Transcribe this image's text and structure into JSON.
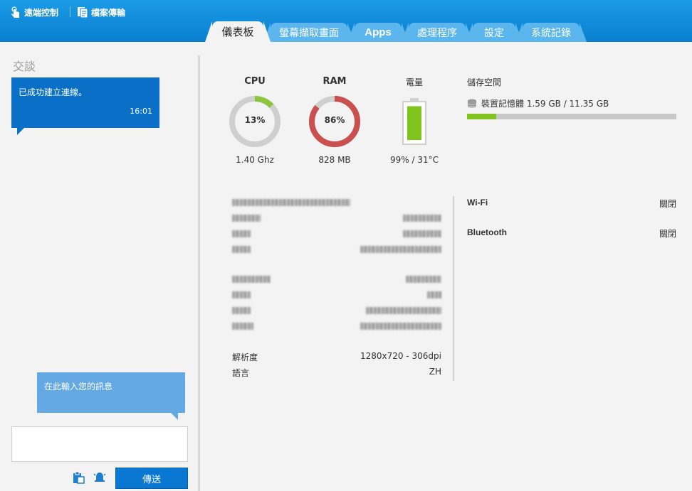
{
  "header": {
    "remote_control": "遠端控制",
    "file_transfer": "檔案傳輸"
  },
  "tabs": [
    "儀表板",
    "螢幕擷取畫面",
    "Apps",
    "處理程序",
    "設定",
    "系統記錄"
  ],
  "chat": {
    "title": "交談",
    "messages": [
      {
        "text": "已成功建立連線。",
        "time": "16:01"
      }
    ],
    "hint": "在此輸入您的訊息",
    "send_label": "傳送"
  },
  "dashboard": {
    "cpu": {
      "label": "CPU",
      "percent": 13,
      "percent_text": "13%",
      "sub": "1.40 Ghz",
      "color": "#8cc63f"
    },
    "ram": {
      "label": "RAM",
      "percent": 86,
      "percent_text": "86%",
      "sub": "828 MB",
      "color": "#c9504e"
    },
    "battery": {
      "label": "電量",
      "level": 99,
      "sub": "99% / 31°C",
      "color": "#7fc31c"
    },
    "storage": {
      "label": "儲存空間",
      "line": "裝置記憶體 1.59 GB / 11.35 GB",
      "used_gb": 1.59,
      "total_gb": 11.35,
      "color": "#7fc31c"
    },
    "info": {
      "resolution_label": "解析度",
      "resolution_value": "1280x720 - 306dpi",
      "language_label": "語言",
      "language_value": "ZH"
    },
    "connectivity": [
      {
        "label": "Wi-Fi",
        "value": "關閉"
      },
      {
        "label": "Bluetooth",
        "value": "關閉"
      }
    ]
  },
  "colors": {
    "header": "#0a7fd0",
    "tab_inactive": "#5bb6ee",
    "send": "#0a77d2"
  }
}
